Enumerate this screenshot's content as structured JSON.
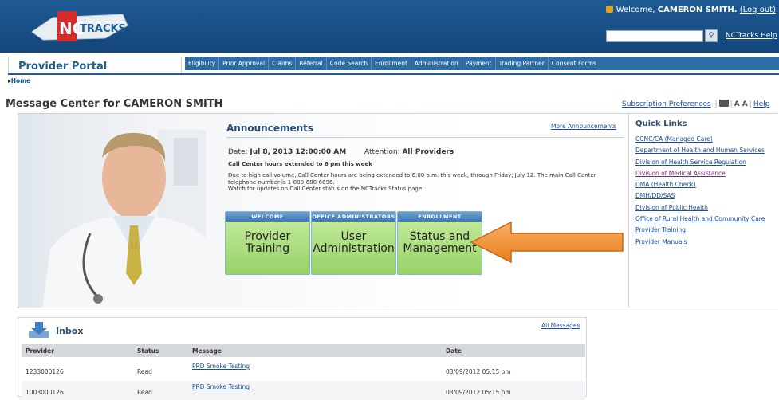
{
  "header": {
    "logo_text": "NCTRACKS",
    "welcome_prefix": "Welcome,",
    "user_name": "CAMERON SMITH.",
    "logout_label": "(Log out)",
    "search_placeholder": "",
    "help_label": "NCTracks Help"
  },
  "nav": {
    "portal_title": "Provider Portal",
    "menu": [
      "Eligibility",
      "Prior Approval",
      "Claims",
      "Referral",
      "Code Search",
      "Enrollment",
      "Administration",
      "Payment",
      "Trading Partner",
      "Consent Forms"
    ],
    "breadcrumb": "Home"
  },
  "page": {
    "title": "Message Center for CAMERON SMITH",
    "subscription_label": "Subscription Preferences",
    "text_size_label": "A A",
    "help_label": "Help"
  },
  "announcements": {
    "title": "Announcements",
    "more_label": "More Announcements",
    "date_label": "Date:",
    "date_value": "Jul 8, 2013 12:00:00 AM",
    "attention_label": "Attention:",
    "attention_value": "All Providers",
    "headline": "Call Center hours extended to 6 pm this week",
    "body_1": "Due to high call volume, Call Center hours are being extended to 6:00 p.m. this week, through Friday, July 12. The main Call Center telephone number is 1-800-688-6696.",
    "body_2": "Watch for updates on Call Center status on the NCTracks Status page."
  },
  "tiles": [
    {
      "caption": "Welcome",
      "line1": "Provider",
      "line2": "Training"
    },
    {
      "caption": "Office Administrators",
      "line1": "User",
      "line2": "Administration"
    },
    {
      "caption": "Enrollment",
      "line1": "Status and",
      "line2": "Management"
    }
  ],
  "quick_links": {
    "title": "Quick Links",
    "items": [
      "CCNC/CA (Managed Care)",
      "Department of Health and Human Services",
      "Division of Health Service Regulation",
      "Division of Medical Assistance",
      "DMA (Health Check)",
      "DMH/DD/SAS",
      "Division of Public Health",
      "Office of Rural Health and Community Care",
      "Provider Training",
      "Provider Manuals"
    ]
  },
  "inbox": {
    "title": "Inbox",
    "all_label": "All Messages",
    "columns": [
      "Provider",
      "Status",
      "Message",
      "Date"
    ],
    "rows": [
      {
        "provider": "1233000126",
        "status": "Read",
        "message": "PRD Smoke Testing",
        "date": "03/09/2012 05:15 pm"
      },
      {
        "provider": "1003000126",
        "status": "Read",
        "message": "PRD Smoke Testing",
        "date": "03/09/2012 05:15 pm"
      }
    ]
  },
  "colors": {
    "header_blue": "#1e5a93",
    "tile_green": "#99d268",
    "arrow_orange": "#f0922e"
  }
}
